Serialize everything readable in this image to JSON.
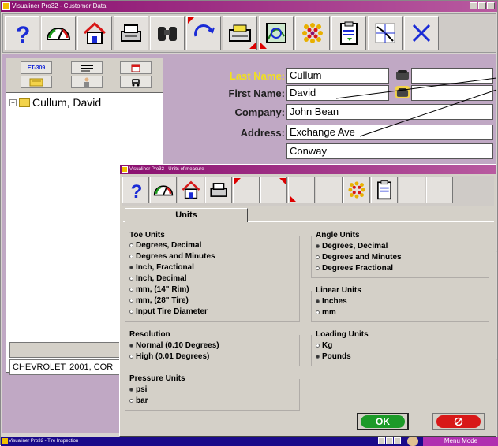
{
  "window": {
    "title": "Visualiner Pro32 - Customer Data"
  },
  "toolbar": {
    "buttons": [
      "help-icon",
      "gauge-icon",
      "home-icon",
      "printer-icon",
      "binoculars-icon",
      "rotate-icon",
      "disk-icon",
      "chart-icon",
      "dots-icon",
      "clipboard-icon",
      "graph-icon",
      "close-icon"
    ]
  },
  "left_panel": {
    "tabs": [
      "ET-309",
      "list",
      "calendar",
      "folder",
      "person",
      "car"
    ],
    "tree_item": "Cullum, David",
    "vehicle": "CHEVROLET, 2001, COR"
  },
  "form": {
    "last_name_label": "Last Name:",
    "last_name": "Cullum",
    "first_name_label": "First Name:",
    "first_name": "David",
    "company_label": "Company:",
    "company": "John Bean",
    "address_label": "Address:",
    "address1": "Exchange Ave",
    "address2": "Conway"
  },
  "dialog": {
    "title": "Visualiner Pro32 - Units of measure",
    "tab": "Units",
    "toe_units": {
      "title": "Toe Units",
      "options": [
        "Degrees, Decimal",
        "Degrees and Minutes",
        "Inch, Fractional",
        "Inch, Decimal",
        "mm, (14\" Rim)",
        "mm, (28\" Tire)",
        "Input Tire Diameter"
      ],
      "selected": 2
    },
    "resolution": {
      "title": "Resolution",
      "options": [
        "Normal (0.10 Degrees)",
        "High (0.01 Degrees)"
      ],
      "selected": 0
    },
    "pressure_units": {
      "title": "Pressure Units",
      "options": [
        "psi",
        "bar"
      ],
      "selected": 0
    },
    "angle_units": {
      "title": "Angle Units",
      "options": [
        "Degrees, Decimal",
        "Degrees and Minutes",
        "Degrees Fractional"
      ],
      "selected": 0
    },
    "linear_units": {
      "title": "Linear Units",
      "options": [
        "Inches",
        "mm"
      ],
      "selected": 0
    },
    "loading_units": {
      "title": "Loading Units",
      "options": [
        "Kg",
        "Pounds"
      ],
      "selected": 1
    },
    "ok_label": "OK"
  },
  "taskbar": {
    "title": "Visualiner Pro32 - Tire Inspection",
    "mode": "Menu Mode"
  },
  "colors": {
    "title_bar": "#8a0f6f",
    "last_name_label": "#f0e020",
    "ok_green": "#1c9a28",
    "cancel_red": "#d81818",
    "taskbar": "#1a0a8a"
  }
}
